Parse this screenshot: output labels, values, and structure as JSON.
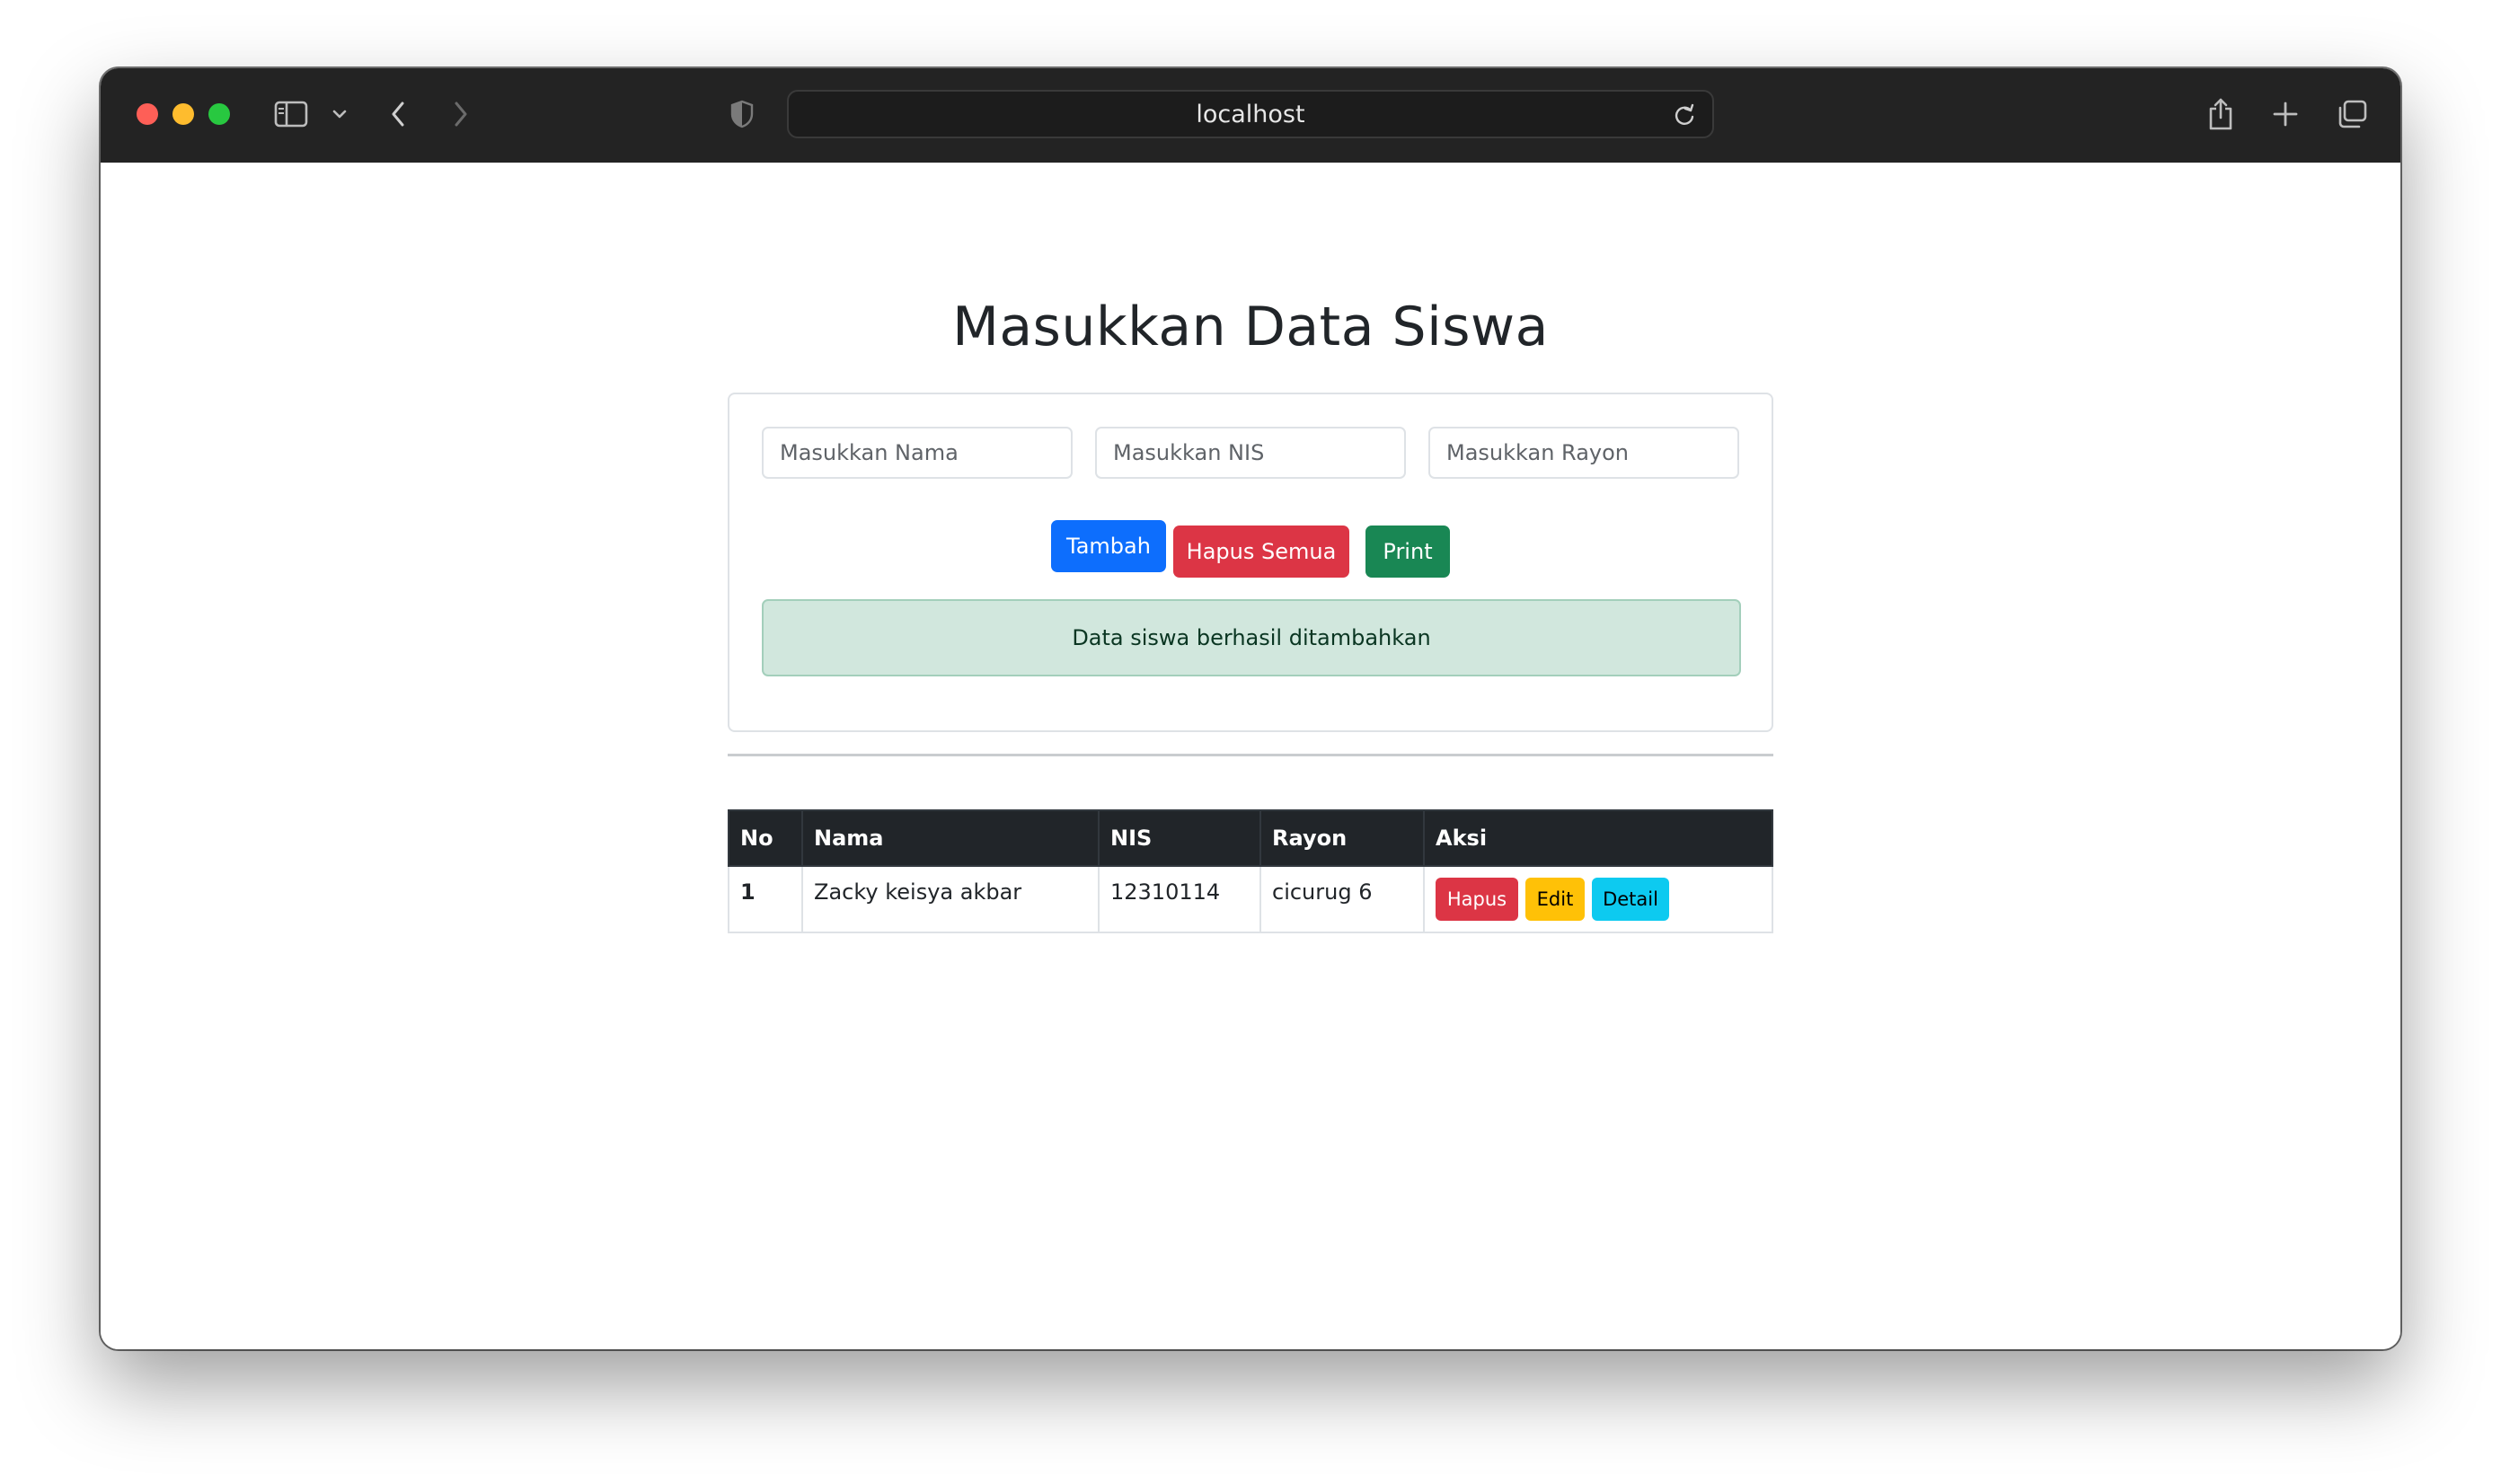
{
  "browser": {
    "url": "localhost"
  },
  "page": {
    "title": "Masukkan Data Siswa"
  },
  "form": {
    "nama_placeholder": "Masukkan Nama",
    "nis_placeholder": "Masukkan NIS",
    "rayon_placeholder": "Masukkan Rayon",
    "tambah_label": "Tambah",
    "hapus_semua_label": "Hapus Semua",
    "print_label": "Print",
    "alert_text": "Data siswa berhasil ditambahkan"
  },
  "table": {
    "headers": {
      "no": "No",
      "nama": "Nama",
      "nis": "NIS",
      "rayon": "Rayon",
      "aksi": "Aksi"
    },
    "rows": [
      {
        "no": "1",
        "nama": "Zacky keisya akbar",
        "nis": "12310114",
        "rayon": "cicurug 6",
        "actions": {
          "hapus": "Hapus",
          "edit": "Edit",
          "detail": "Detail"
        }
      }
    ]
  },
  "colors": {
    "primary": "#0d6efd",
    "danger": "#dc3545",
    "success": "#198754",
    "warning": "#ffc107",
    "info": "#0dcaf0",
    "alert_bg": "#d1e7dd",
    "table_header_bg": "#212529"
  },
  "icons": {
    "sidebar": "sidebar-icon",
    "chevron": "chevron-down-icon",
    "back": "back-arrow-icon",
    "forward": "forward-arrow-icon",
    "shield": "privacy-shield-icon",
    "reload": "reload-icon",
    "share": "share-icon",
    "new_tab": "plus-icon",
    "tabs": "tab-overview-icon"
  }
}
